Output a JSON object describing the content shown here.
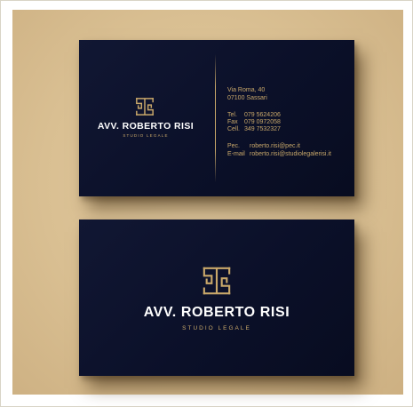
{
  "image": {
    "background_color": "#d9bf92",
    "card_color": "#0b1029",
    "accent_color": "#c9a86a",
    "logo_icon": "greek-key-monogram-icon"
  },
  "front_card": {
    "name": "AVV. ROBERTO RISI",
    "subtitle": "STUDIO LEGALE",
    "address_line1": "Via Roma, 40",
    "address_line2": "07100 Sassari",
    "tel_label": "Tel.",
    "tel_value": "079 5624206",
    "fax_label": "Fax",
    "fax_value": "079 0972058",
    "cell_label": "Cell.",
    "cell_value": "349 7532327",
    "pec_label": "Pec.",
    "pec_value": "roberto.risi@pec.it",
    "email_label": "E-mail",
    "email_value": "roberto.risi@studiolegalerisi.it"
  },
  "back_card": {
    "name": "AVV. ROBERTO RISI",
    "subtitle": "STUDIO LEGALE"
  }
}
